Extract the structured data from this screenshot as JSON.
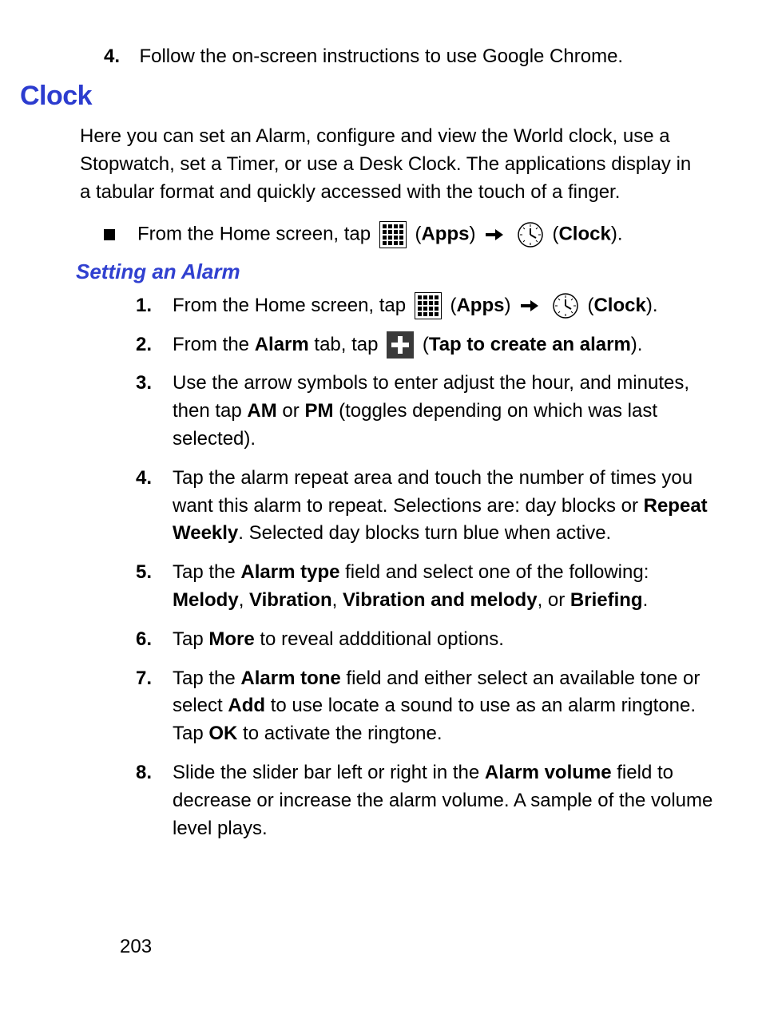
{
  "top_step": {
    "num": "4.",
    "text": "Follow the on-screen instructions to use Google Chrome."
  },
  "section_title": "Clock",
  "intro": "Here you can set an Alarm, configure and view the World clock, use a Stopwatch, set a Timer, or use a Desk Clock. The applications display in a tabular format and quickly accessed with the touch of a finger.",
  "nav": {
    "prefix": "From the Home screen, tap ",
    "apps": "Apps",
    "clock": "Clock"
  },
  "sub_title": "Setting an Alarm",
  "steps": {
    "s1": {
      "num": "1.",
      "prefix": "From the Home screen, tap ",
      "apps": "Apps",
      "clock": "Clock"
    },
    "s2": {
      "num": "2.",
      "a": "From the ",
      "alarm": "Alarm",
      "b": " tab, tap ",
      "tap_create": "Tap to create an alarm"
    },
    "s3": {
      "num": "3.",
      "a": "Use the arrow symbols to enter adjust the hour, and minutes, then tap ",
      "am": "AM",
      "or": " or ",
      "pm": "PM",
      "b": " (toggles depending on which was last selected)."
    },
    "s4": {
      "num": "4.",
      "a": "Tap the alarm repeat area and touch the number of times you want this alarm to repeat. Selections are: day blocks or ",
      "rw": "Repeat Weekly",
      "b": ". Selected day blocks turn blue when active."
    },
    "s5": {
      "num": "5.",
      "a": "Tap the ",
      "at": "Alarm type",
      "b": " field and select one of the following: ",
      "m": "Melody",
      "c1": ", ",
      "v": "Vibration",
      "c2": ", ",
      "vm": "Vibration and melody",
      "c3": ", or ",
      "br": "Briefing",
      "p": "."
    },
    "s6": {
      "num": "6.",
      "a": "Tap ",
      "more": "More",
      "b": " to reveal addditional options."
    },
    "s7": {
      "num": "7.",
      "a": "Tap the ",
      "atone": "Alarm tone",
      "b": " field and either select an available tone or select ",
      "add": "Add",
      "c": " to use locate a sound to use as an alarm ringtone. Tap ",
      "ok": "OK",
      "d": " to activate the ringtone."
    },
    "s8": {
      "num": "8.",
      "a": "Slide the slider bar left or right in the ",
      "av": "Alarm volume",
      "b": " field to decrease or increase the alarm volume. A sample of the volume level plays."
    }
  },
  "page_number": "203"
}
